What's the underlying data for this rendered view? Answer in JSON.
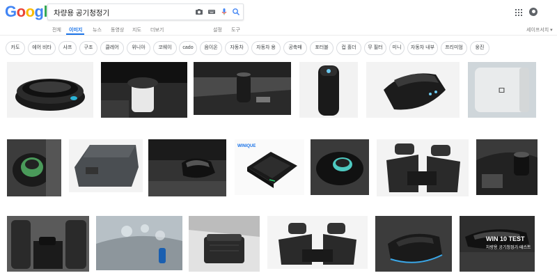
{
  "brand": {
    "letters": [
      "G",
      "o",
      "o",
      "g",
      "l",
      "e"
    ],
    "colors": [
      "#4285F4",
      "#EA4335",
      "#FBBC05",
      "#4285F4",
      "#34A853",
      "#EA4335"
    ]
  },
  "search": {
    "query": "차량용 공기청정기"
  },
  "tabs": [
    {
      "label": "전체",
      "active": false
    },
    {
      "label": "이미지",
      "active": true
    },
    {
      "label": "뉴스",
      "active": false
    },
    {
      "label": "동영상",
      "active": false
    },
    {
      "label": "지도",
      "active": false
    },
    {
      "label": "더보기",
      "active": false
    }
  ],
  "tools": {
    "settings": "설정",
    "tools": "도구",
    "safesearch": "세이프서치 ▾"
  },
  "chips": [
    "카도",
    "에어 비타",
    "샤프",
    "구조",
    "클레어",
    "위니아",
    "코웨이",
    "cado",
    "음이온",
    "자동차",
    "자동차 용",
    "공축매",
    "포터블",
    "컵 홀더",
    "무 필터",
    "미니",
    "자동차 내부",
    "프리미엄",
    "웅진"
  ],
  "images": {
    "row1": [
      "car-air-purifier-round-black",
      "purifier-in-cup-holder",
      "cylinder-purifier-car-console",
      "tall-black-cylinder-purifier",
      "wedge-black-purifier",
      "white-cube-purifier"
    ],
    "row2": [
      "knob-purifier-car-console",
      "grey-box-purifier",
      "purifier-on-dashboard",
      "square-purifier-brand",
      "round-purifier-car-seat",
      "twin-purifier-headrests",
      "purifier-gear-console"
    ],
    "row3": [
      "purifier-car-seats-interior",
      "car-interior-air-flow",
      "black-box-purifier-seat",
      "twin-headrest-purifier",
      "purifier-blue-light-console",
      "win10-test-purifier"
    ]
  },
  "overlay": {
    "title": "WIN 10 TEST",
    "subtitle": "차량용 공기청정기 테스트"
  },
  "brand_label": "WINIQUE"
}
